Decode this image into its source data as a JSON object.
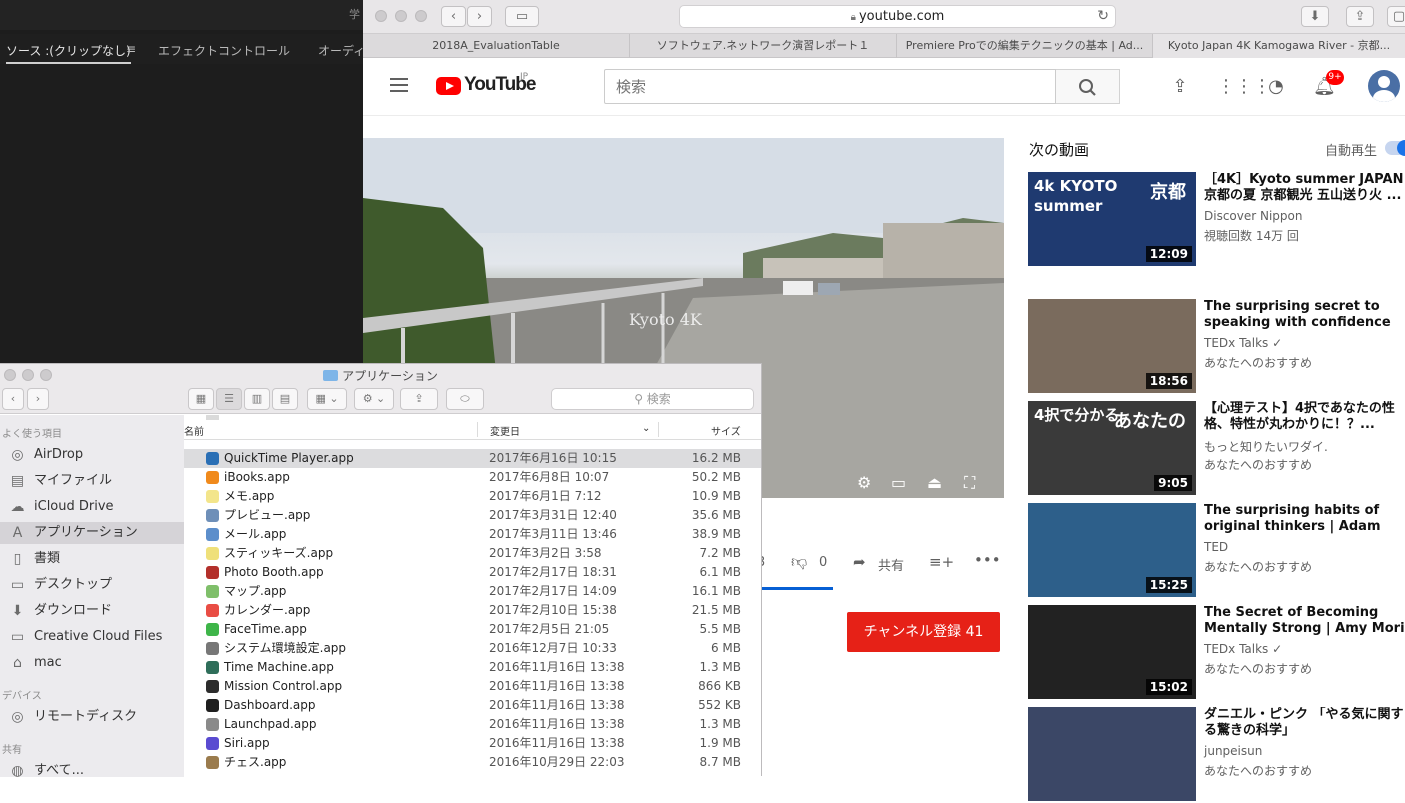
{
  "premiere": {
    "title_fragment": "学",
    "tabs": [
      "ソース :(クリップなし)",
      "エフェクトコントロール",
      "オーディ"
    ],
    "menu_icon": "≡"
  },
  "safari": {
    "url": "youtube.com",
    "tabs": [
      "2018A_EvaluationTable",
      "ソフトウェア.ネットワーク演習レポート１",
      "Premiere Proでの編集テクニックの基本 | Ad...",
      "Kyoto Japan 4K Kamogawa River - 京都..."
    ]
  },
  "youtube": {
    "logo_word": "YouTube",
    "logo_region": "JP",
    "search_placeholder": "検索",
    "notification_count": "9+",
    "video_watermark": "Kyoto 4K",
    "dislike_count": "0",
    "share_label": "共有",
    "like_count_partial": "3",
    "subscribe_label": "チャンネル登録 41",
    "up_next_label": "次の動画",
    "autoplay_label": "自動再生",
    "recommendations": [
      {
        "title": "［4K］Kyoto summer JAPAN 京都の夏 京都観光 五山送り火 ...",
        "channel": "Discover Nippon",
        "meta": "視聴回数 14万 回",
        "duration": "12:09",
        "thumb_text_a": "4k KYOTO summer",
        "thumb_text_b": "京都",
        "thumb_color": "#1f3a70"
      },
      {
        "title": "The surprising secret to speaking with confidence |...",
        "channel": "TEDx Talks ✓",
        "meta": "あなたへのおすすめ",
        "duration": "18:56",
        "thumb_color": "#7a6b5d"
      },
      {
        "title": "【心理テスト】4択であなたの性格、特性が丸わかりに！？...",
        "channel": "もっと知りたいワダイ.",
        "meta": "あなたへのおすすめ",
        "duration": "9:05",
        "thumb_text_a": "4択で分かる",
        "thumb_text_b": "あなたの",
        "thumb_color": "#3a3a3a"
      },
      {
        "title": "The surprising habits of original thinkers | Adam Grant",
        "channel": "TED",
        "meta": "あなたへのおすすめ",
        "duration": "15:25",
        "thumb_color": "#2d5f8a"
      },
      {
        "title": "The Secret of Becoming Mentally Strong | Amy Morin |...",
        "channel": "TEDx Talks ✓",
        "meta": "あなたへのおすすめ",
        "duration": "15:02",
        "thumb_color": "#222222"
      },
      {
        "title": "ダニエル・ピンク 「やる気に関する驚きの科学」",
        "channel": "junpeisun",
        "meta": "あなたへのおすすめ",
        "duration": "",
        "thumb_color": "#3b4766"
      }
    ]
  },
  "finder": {
    "title": "アプリケーション",
    "search_placeholder": "検索",
    "sidebar_sections": {
      "favorites": "よく使う項目",
      "devices": "デバイス",
      "shared": "共有"
    },
    "sidebar_favorites": [
      {
        "label": "AirDrop",
        "icon": "airdrop-icon",
        "glyph": "◎"
      },
      {
        "label": "マイファイル",
        "icon": "all-files-icon",
        "glyph": "▤"
      },
      {
        "label": "iCloud Drive",
        "icon": "cloud-icon",
        "glyph": "☁"
      },
      {
        "label": "アプリケーション",
        "icon": "applications-icon",
        "glyph": "A"
      },
      {
        "label": "書類",
        "icon": "documents-icon",
        "glyph": "▯"
      },
      {
        "label": "デスクトップ",
        "icon": "desktop-icon",
        "glyph": "▭"
      },
      {
        "label": "ダウンロード",
        "icon": "download-icon",
        "glyph": "⬇"
      },
      {
        "label": "Creative Cloud Files",
        "icon": "folder-icon",
        "glyph": "▭"
      },
      {
        "label": "mac",
        "icon": "home-icon",
        "glyph": "⌂"
      }
    ],
    "sidebar_devices": [
      {
        "label": "リモートディスク",
        "icon": "disc-icon",
        "glyph": "◎"
      }
    ],
    "sidebar_shared": [
      {
        "label": "すべて...",
        "icon": "network-icon",
        "glyph": "◍"
      }
    ],
    "columns": {
      "name": "名前",
      "date": "変更日",
      "size": "サイズ"
    },
    "files": [
      {
        "name": "QuickTime Player.app",
        "date": "2017年6月16日 10:15",
        "size": "16.2 MB",
        "color": "#2a6fb5",
        "selected": true
      },
      {
        "name": "iBooks.app",
        "date": "2017年6月8日 10:07",
        "size": "50.2 MB",
        "color": "#f08a1c"
      },
      {
        "name": "メモ.app",
        "date": "2017年6月1日 7:12",
        "size": "10.9 MB",
        "color": "#f3e58b"
      },
      {
        "name": "プレビュー.app",
        "date": "2017年3月31日 12:40",
        "size": "35.6 MB",
        "color": "#6e8fb8"
      },
      {
        "name": "メール.app",
        "date": "2017年3月11日 13:46",
        "size": "38.9 MB",
        "color": "#5c8ecb"
      },
      {
        "name": "スティッキーズ.app",
        "date": "2017年3月2日 3:58",
        "size": "7.2 MB",
        "color": "#efe07a"
      },
      {
        "name": "Photo Booth.app",
        "date": "2017年2月17日 18:31",
        "size": "6.1 MB",
        "color": "#b3302b"
      },
      {
        "name": "マップ.app",
        "date": "2017年2月17日 14:09",
        "size": "16.1 MB",
        "color": "#7fbf6a"
      },
      {
        "name": "カレンダー.app",
        "date": "2017年2月10日 15:38",
        "size": "21.5 MB",
        "color": "#e94d44"
      },
      {
        "name": "FaceTime.app",
        "date": "2017年2月5日 21:05",
        "size": "5.5 MB",
        "color": "#3eb549"
      },
      {
        "name": "システム環境設定.app",
        "date": "2016年12月7日 10:33",
        "size": "6 MB",
        "color": "#777777"
      },
      {
        "name": "Time Machine.app",
        "date": "2016年11月16日 13:38",
        "size": "1.3 MB",
        "color": "#2f6e5a"
      },
      {
        "name": "Mission Control.app",
        "date": "2016年11月16日 13:38",
        "size": "866 KB",
        "color": "#2c2c2c"
      },
      {
        "name": "Dashboard.app",
        "date": "2016年11月16日 13:38",
        "size": "552 KB",
        "color": "#1f1f1f"
      },
      {
        "name": "Launchpad.app",
        "date": "2016年11月16日 13:38",
        "size": "1.3 MB",
        "color": "#8a8a8a"
      },
      {
        "name": "Siri.app",
        "date": "2016年11月16日 13:38",
        "size": "1.9 MB",
        "color": "#5a4bd1"
      },
      {
        "name": "チェス.app",
        "date": "2016年10月29日 22:03",
        "size": "8.7 MB",
        "color": "#9a7b4d"
      }
    ]
  }
}
